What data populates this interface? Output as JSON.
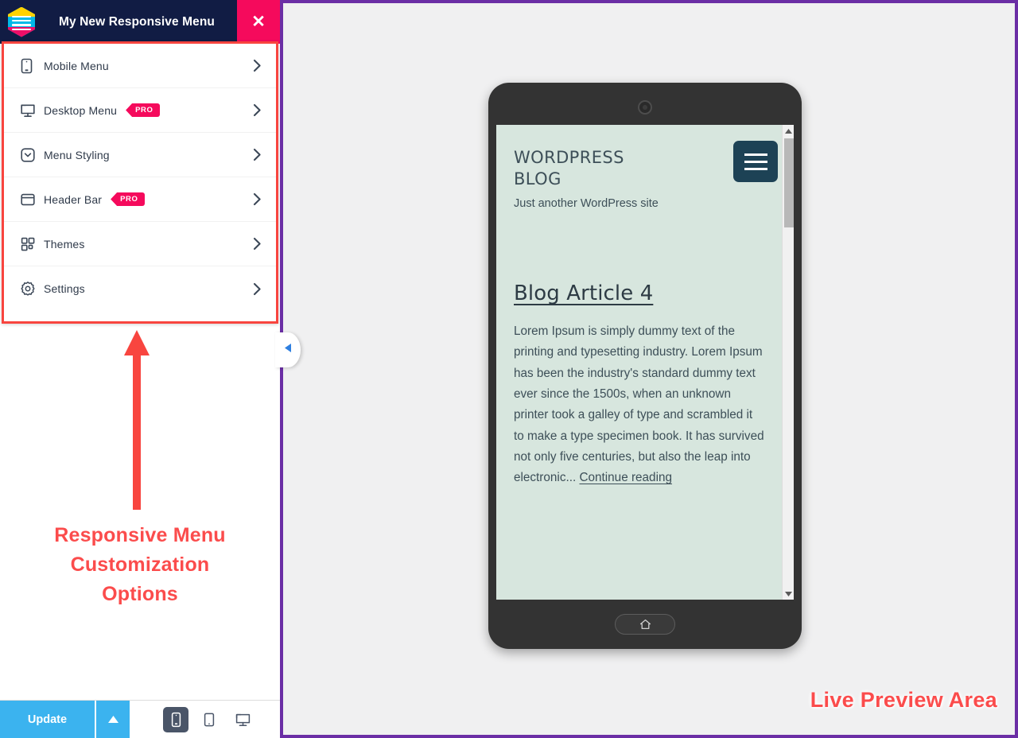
{
  "panel": {
    "title": "My New Responsive Menu",
    "logo_icon": "responsive-menu-hexagon-logo",
    "close_label": "✕",
    "menu_items": [
      {
        "label": "Mobile Menu",
        "icon": "mobile-phone-icon",
        "badge": "",
        "chevron": "›"
      },
      {
        "label": "Desktop Menu",
        "icon": "desktop-monitor-icon",
        "badge": "PRO",
        "chevron": "›"
      },
      {
        "label": "Menu Styling",
        "icon": "chevron-down-box-icon",
        "badge": "",
        "chevron": "›"
      },
      {
        "label": "Header Bar",
        "icon": "header-bar-icon",
        "badge": "PRO",
        "chevron": "›"
      },
      {
        "label": "Themes",
        "icon": "grid-squares-icon",
        "badge": "",
        "chevron": "›"
      },
      {
        "label": "Settings",
        "icon": "gear-icon",
        "badge": "",
        "chevron": "›"
      }
    ]
  },
  "annotations": {
    "left": "Responsive Menu\nCustomization\nOptions",
    "right": "Live Preview Area",
    "arrow_icon": "red-up-arrow",
    "color": "#fb4c4c"
  },
  "bottom_bar": {
    "update_label": "Update",
    "update_toggle_icon": "caret-up-icon",
    "devices": [
      {
        "name": "mobile",
        "icon": "mobile-device-icon",
        "active": true
      },
      {
        "name": "tablet",
        "icon": "tablet-device-icon",
        "active": false
      },
      {
        "name": "desktop",
        "icon": "desktop-device-icon",
        "active": false
      }
    ]
  },
  "collapse_handle": {
    "icon": "collapse-left-caret-icon",
    "color": "#2e7fe0"
  },
  "preview": {
    "border_color": "#6b2ea5",
    "background": "#f0f0f1",
    "phone": {
      "camera_icon": "front-camera-icon",
      "home_icon": "home-icon",
      "screen_background": "#d7e6de"
    },
    "site": {
      "title": "WORDPRESS BLOG",
      "tagline": "Just another WordPress site",
      "toggle_icon": "hamburger-menu-icon",
      "toggle_color": "#1d4255",
      "post_title": "Blog Article 4",
      "post_body": "Lorem Ipsum is simply dummy text of the printing and typesetting industry. Lorem Ipsum has been the industry's standard dummy text ever since the 1500s, when an unknown printer took a galley of type and scrambled it to make a type specimen book. It has survived not only five centuries, but also the leap into electronic...",
      "post_more": "Continue reading"
    },
    "scrollbar": {
      "up_icon": "scroll-up-arrow",
      "down_icon": "scroll-down-arrow"
    }
  }
}
